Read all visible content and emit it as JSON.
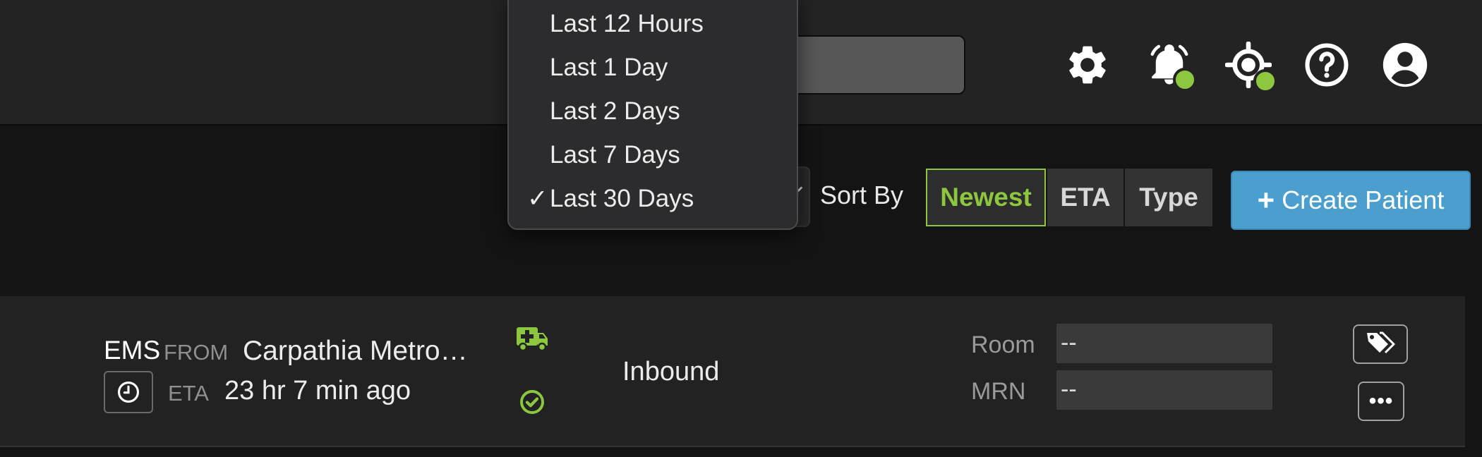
{
  "header": {
    "icons": [
      "gear-icon",
      "bell-icon",
      "crosshair-location-icon",
      "help-circle-icon",
      "user-account-icon"
    ],
    "status_color": "#8dc63f"
  },
  "time_filter": {
    "options": [
      "Last 12 Hours",
      "Last 1 Day",
      "Last 2 Days",
      "Last 7 Days",
      "Last 30 Days"
    ],
    "selected": "Last 30 Days",
    "check_mark": "✓"
  },
  "sort": {
    "label": "Sort By",
    "options": [
      "Newest",
      "ETA",
      "Type"
    ],
    "active": "Newest",
    "active_color": "#8dc63f"
  },
  "create_patient": {
    "plus": "+",
    "label": "Create Patient",
    "color": "#4a9fcf"
  },
  "patients": [
    {
      "mode": "EMS",
      "from_label": "FROM",
      "origin": "Carpathia Metro…",
      "eta_label": "ETA",
      "eta": "23 hr 7 min ago",
      "status": "Inbound",
      "room_label": "Room",
      "room": "--",
      "mrn_label": "MRN",
      "mrn": "--",
      "more": "•••"
    }
  ]
}
